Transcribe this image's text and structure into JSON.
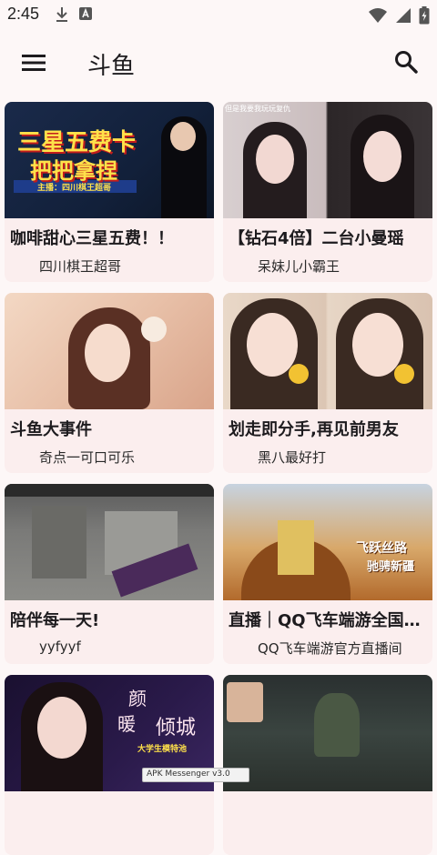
{
  "status": {
    "time": "2:45",
    "left_icons": [
      "download-icon",
      "a-letter-icon"
    ],
    "right_icons": [
      "wifi-icon",
      "signal-icon",
      "battery-charging-icon"
    ]
  },
  "app_bar": {
    "menu_icon": "hamburger-menu-icon",
    "title": "斗鱼",
    "search_icon": "search-icon"
  },
  "cards": [
    {
      "title": "咖啡甜心三星五费！！",
      "subtitle": "四川棋王超哥",
      "thumb_text": [
        "三星五费卡",
        "把把拿捏",
        "主播：四川棋王超哥"
      ]
    },
    {
      "title": "【钻石4倍】二台小曼瑶",
      "subtitle": "呆妹儿小霸王",
      "thumb_text": [
        "但是我要我玩玩复仇"
      ]
    },
    {
      "title": "斗鱼大事件",
      "subtitle": "奇点一可口可乐",
      "thumb_text": []
    },
    {
      "title": "划走即分手,再见前男友",
      "subtitle": "黑八最好打",
      "thumb_text": []
    },
    {
      "title": "陪伴每一天!",
      "subtitle": "yyfyyf",
      "thumb_text": []
    },
    {
      "title": "直播｜QQ飞车端游全国…",
      "subtitle": "QQ飞车端游官方直播间",
      "thumb_text": [
        "飞跃丝路",
        "驰骋新疆"
      ]
    },
    {
      "title": "",
      "subtitle": "",
      "thumb_text": [
        "颜",
        "暖",
        "倾城",
        "大学生模特池"
      ]
    },
    {
      "title": "",
      "subtitle": "",
      "thumb_text": []
    }
  ],
  "toast": {
    "text": "APK Messenger v3.0"
  },
  "colors": {
    "background": "#fdf7f7",
    "card": "#fbeeee"
  }
}
